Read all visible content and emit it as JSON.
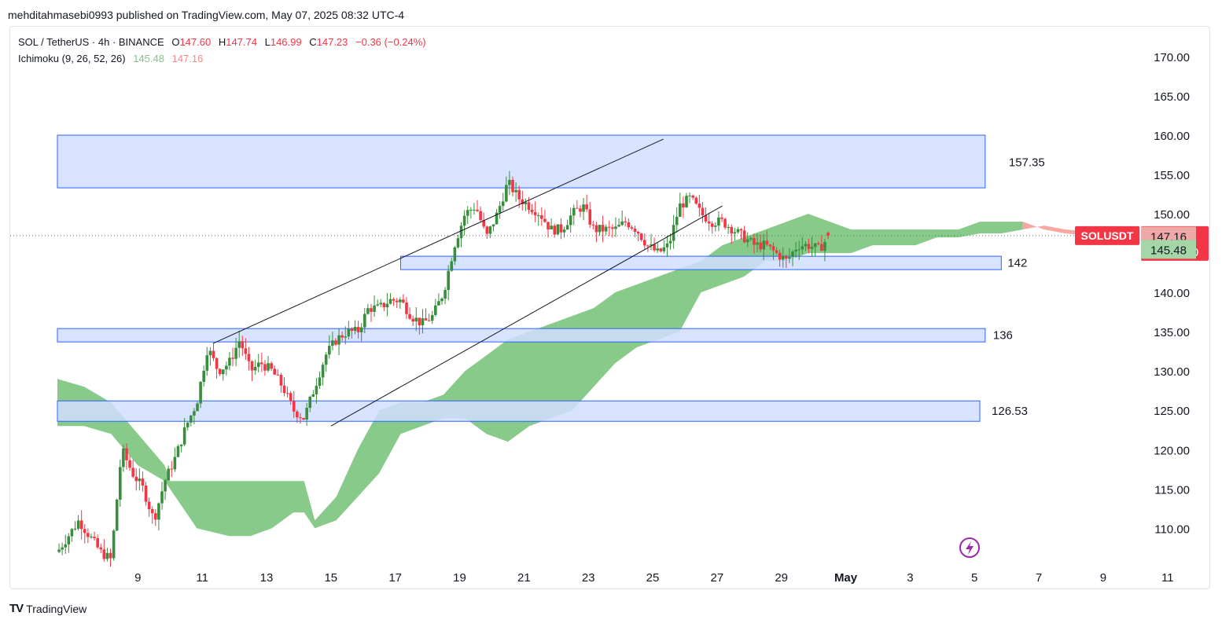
{
  "header": {
    "published_line": "mehditahmasebi0993 published on TradingView.com, May 07, 2025 08:32 UTC-4"
  },
  "legend": {
    "symbol": "SOL / TetherUS · 4h · BINANCE",
    "open_label": "O",
    "open": "147.60",
    "high_label": "H",
    "high": "147.74",
    "low_label": "L",
    "low": "146.99",
    "close_label": "C",
    "close": "147.23",
    "change": "−0.36 (−0.24%)",
    "indicator": "Ichimoku (9, 26, 52, 26)",
    "ind_value_1": "145.48",
    "ind_value_2": "147.16"
  },
  "footer": {
    "brand": "TradingView"
  },
  "colors": {
    "up": "#388e3c",
    "down": "#f23645",
    "zone_fill": "#d1deff",
    "zone_border": "#2962ff",
    "cloud_bull": "#81c784",
    "cloud_bear": "#f5a49e"
  },
  "chart_data": {
    "type": "candlestick",
    "ylim": [
      105,
      175
    ],
    "y_ticks": [
      "110.00",
      "115.00",
      "120.00",
      "125.00",
      "130.00",
      "135.00",
      "140.00",
      "145.00",
      "150.00",
      "155.00",
      "160.00",
      "165.00",
      "170.00"
    ],
    "x_ticks": [
      {
        "label": "9",
        "t": 15
      },
      {
        "label": "11",
        "t": 27
      },
      {
        "label": "13",
        "t": 39
      },
      {
        "label": "15",
        "t": 51
      },
      {
        "label": "17",
        "t": 63
      },
      {
        "label": "19",
        "t": 75
      },
      {
        "label": "21",
        "t": 87
      },
      {
        "label": "23",
        "t": 99
      },
      {
        "label": "25",
        "t": 111
      },
      {
        "label": "27",
        "t": 123
      },
      {
        "label": "29",
        "t": 135
      },
      {
        "label": "May",
        "t": 147
      },
      {
        "label": "3",
        "t": 159
      },
      {
        "label": "5",
        "t": 171
      },
      {
        "label": "7",
        "t": 183
      },
      {
        "label": "9",
        "t": 195
      },
      {
        "label": "11",
        "t": 207
      }
    ],
    "price_path": [
      [
        0,
        107
      ],
      [
        4,
        111
      ],
      [
        8,
        107
      ],
      [
        10,
        106
      ],
      [
        12,
        120
      ],
      [
        14,
        117
      ],
      [
        16,
        115
      ],
      [
        18,
        111
      ],
      [
        20,
        116
      ],
      [
        22,
        119
      ],
      [
        24,
        123
      ],
      [
        26,
        126
      ],
      [
        28,
        133
      ],
      [
        30,
        130
      ],
      [
        32,
        131
      ],
      [
        34,
        134
      ],
      [
        36,
        130
      ],
      [
        38,
        131
      ],
      [
        40,
        130
      ],
      [
        42,
        128
      ],
      [
        44,
        125
      ],
      [
        46,
        124
      ],
      [
        48,
        128
      ],
      [
        50,
        132
      ],
      [
        52,
        134
      ],
      [
        54,
        135
      ],
      [
        56,
        135
      ],
      [
        58,
        138
      ],
      [
        60,
        138
      ],
      [
        62,
        139
      ],
      [
        64,
        139
      ],
      [
        66,
        137
      ],
      [
        68,
        136
      ],
      [
        70,
        137
      ],
      [
        72,
        140
      ],
      [
        74,
        146
      ],
      [
        76,
        150
      ],
      [
        78,
        151
      ],
      [
        80,
        147
      ],
      [
        82,
        150
      ],
      [
        84,
        154
      ],
      [
        86,
        152
      ],
      [
        88,
        151
      ],
      [
        90,
        150
      ],
      [
        92,
        148
      ],
      [
        94,
        148
      ],
      [
        96,
        150
      ],
      [
        98,
        151
      ],
      [
        100,
        148
      ],
      [
        102,
        148
      ],
      [
        104,
        148
      ],
      [
        106,
        149
      ],
      [
        108,
        148
      ],
      [
        110,
        146
      ],
      [
        112,
        145
      ],
      [
        114,
        146
      ],
      [
        116,
        151
      ],
      [
        118,
        152
      ],
      [
        120,
        150
      ],
      [
        122,
        149
      ],
      [
        124,
        149
      ],
      [
        126,
        148
      ],
      [
        128,
        147
      ],
      [
        130,
        146
      ],
      [
        132,
        146
      ],
      [
        134,
        145
      ],
      [
        136,
        144
      ],
      [
        138,
        146
      ],
      [
        140,
        146
      ],
      [
        142,
        145.5
      ],
      [
        144,
        147.23
      ]
    ],
    "ohlc_last": {
      "open": 147.6,
      "high": 147.74,
      "low": 146.99,
      "close": 147.23
    },
    "zones": [
      {
        "low": 153.3,
        "high": 160.0,
        "t_start": 0,
        "t_end": 173,
        "label": "157.35"
      },
      {
        "low": 142.9,
        "high": 144.6,
        "t_start": 64,
        "t_end": 176,
        "label": "142"
      },
      {
        "low": 133.7,
        "high": 135.4,
        "t_start": 0,
        "t_end": 173,
        "label": "136"
      },
      {
        "low": 123.6,
        "high": 126.2,
        "t_start": 0,
        "t_end": 172,
        "label": "126.53"
      }
    ],
    "trendlines": [
      {
        "t1": 29,
        "p1": 133.5,
        "t2": 113,
        "p2": 159.5
      },
      {
        "t1": 51,
        "p1": 123.0,
        "t2": 124,
        "p2": 151.0
      }
    ],
    "cloud_span_a": [
      [
        0,
        129
      ],
      [
        5,
        128
      ],
      [
        10,
        126
      ],
      [
        15,
        122
      ],
      [
        20,
        118
      ],
      [
        21,
        116
      ],
      [
        26,
        116
      ],
      [
        32,
        116
      ],
      [
        36,
        116
      ],
      [
        40,
        116
      ],
      [
        44,
        116
      ],
      [
        46,
        116
      ],
      [
        48,
        111
      ],
      [
        52,
        114
      ],
      [
        56,
        120
      ],
      [
        60,
        125
      ],
      [
        64,
        126
      ],
      [
        68,
        126
      ],
      [
        72,
        127
      ],
      [
        76,
        130
      ],
      [
        80,
        132
      ],
      [
        84,
        134
      ],
      [
        88,
        135
      ],
      [
        92,
        136
      ],
      [
        96,
        137
      ],
      [
        100,
        138
      ],
      [
        104,
        140
      ],
      [
        108,
        141
      ],
      [
        112,
        142
      ],
      [
        116,
        143
      ],
      [
        120,
        144
      ],
      [
        124,
        146
      ],
      [
        128,
        147
      ],
      [
        132,
        148
      ],
      [
        136,
        149
      ],
      [
        140,
        150
      ],
      [
        144,
        149
      ],
      [
        148,
        148
      ],
      [
        152,
        148
      ],
      [
        156,
        148
      ],
      [
        160,
        148
      ],
      [
        164,
        148
      ],
      [
        168,
        148
      ],
      [
        172,
        149
      ],
      [
        176,
        149
      ],
      [
        180,
        149
      ],
      [
        184,
        148
      ],
      [
        188,
        147.5
      ],
      [
        196,
        147
      ],
      [
        202,
        146.5
      ]
    ],
    "cloud_span_b": [
      [
        0,
        123
      ],
      [
        5,
        123
      ],
      [
        10,
        122
      ],
      [
        15,
        118
      ],
      [
        20,
        116
      ],
      [
        21,
        115
      ],
      [
        26,
        110
      ],
      [
        32,
        109
      ],
      [
        36,
        109
      ],
      [
        40,
        110
      ],
      [
        44,
        112
      ],
      [
        46,
        112
      ],
      [
        48,
        110
      ],
      [
        52,
        111
      ],
      [
        56,
        114
      ],
      [
        60,
        117
      ],
      [
        64,
        122
      ],
      [
        68,
        123
      ],
      [
        72,
        124
      ],
      [
        76,
        124
      ],
      [
        80,
        122
      ],
      [
        84,
        121
      ],
      [
        88,
        123
      ],
      [
        92,
        124
      ],
      [
        96,
        125
      ],
      [
        100,
        128
      ],
      [
        104,
        131
      ],
      [
        108,
        133
      ],
      [
        112,
        134
      ],
      [
        116,
        135
      ],
      [
        120,
        140
      ],
      [
        124,
        141
      ],
      [
        128,
        142
      ],
      [
        132,
        144
      ],
      [
        136,
        144
      ],
      [
        140,
        145
      ],
      [
        144,
        145
      ],
      [
        148,
        145
      ],
      [
        152,
        146
      ],
      [
        156,
        146
      ],
      [
        160,
        146
      ],
      [
        164,
        147
      ],
      [
        168,
        147
      ],
      [
        172,
        147.5
      ],
      [
        176,
        147.5
      ],
      [
        180,
        148
      ],
      [
        184,
        148.5
      ],
      [
        188,
        148
      ],
      [
        196,
        147.5
      ],
      [
        202,
        147
      ]
    ],
    "labels": {
      "symbol_tag": "SOLUSDT",
      "last_price": "147.23",
      "countdown": "03:27:20",
      "span_red_value": "147.16",
      "span_green_value": "145.48"
    }
  }
}
